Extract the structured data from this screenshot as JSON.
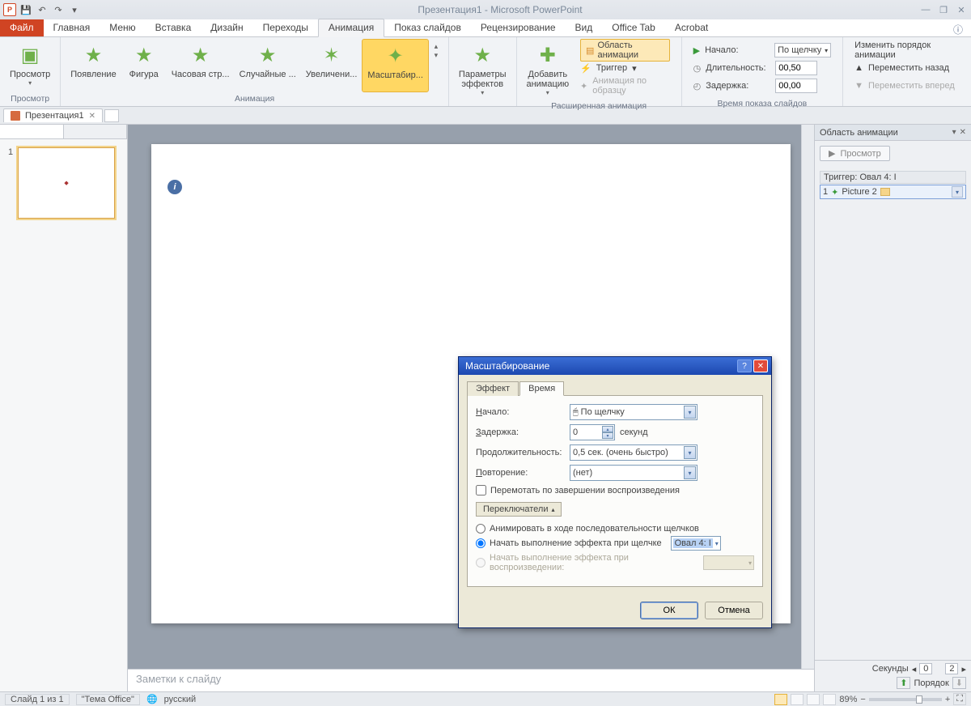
{
  "title": "Презентация1 - Microsoft PowerPoint",
  "menutabs": {
    "file": "Файл",
    "items": [
      "Главная",
      "Меню",
      "Вставка",
      "Дизайн",
      "Переходы",
      "Анимация",
      "Показ слайдов",
      "Рецензирование",
      "Вид",
      "Office Tab",
      "Acrobat"
    ],
    "active_index": 5
  },
  "ribbon": {
    "preview": {
      "label": "Просмотр",
      "group": "Просмотр"
    },
    "anim_gallery": {
      "items": [
        "Появление",
        "Фигура",
        "Часовая стр...",
        "Случайные ...",
        "Увеличени...",
        "Масштабир..."
      ],
      "selected_index": 5,
      "group": "Анимация"
    },
    "effect_options": "Параметры эффектов",
    "add_anim": "Добавить анимацию",
    "ext_anim": {
      "pane": "Область анимации",
      "trigger": "Триггер",
      "painter": "Анимация по образцу",
      "group": "Расширенная анимация"
    },
    "timing": {
      "start_lbl": "Начало:",
      "start_val": "По щелчку",
      "duration_lbl": "Длительность:",
      "duration_val": "00,50",
      "delay_lbl": "Задержка:",
      "delay_val": "00,00",
      "group": "Время показа слайдов"
    },
    "reorder": {
      "title": "Изменить порядок анимации",
      "back": "Переместить назад",
      "fwd": "Переместить вперед"
    }
  },
  "doctab": {
    "name": "Презентация1"
  },
  "thumb": {
    "num": "1"
  },
  "notes_placeholder": "Заметки к слайду",
  "anim_pane": {
    "title": "Область анимации",
    "play": "Просмотр",
    "trigger_hdr": "Триггер: Овал 4: I",
    "item_num": "1",
    "item_name": "Picture 2",
    "seconds": "Секунды",
    "sec_a": "0",
    "sec_b": "2",
    "reorder": "Порядок"
  },
  "dialog": {
    "title": "Масштабирование",
    "tab_effect": "Эффект",
    "tab_time": "Время",
    "start_lbl": "Начало:",
    "start_val": "По щелчку",
    "delay_lbl": "Задержка:",
    "delay_val": "0",
    "delay_unit": "секунд",
    "duration_lbl": "Продолжительность:",
    "duration_val": "0,5 сек. (очень быстро)",
    "repeat_lbl": "Повторение:",
    "repeat_val": "(нет)",
    "rewind": "Перемотать по завершении воспроизведения",
    "triggers_btn": "Переключатели",
    "radio1": "Анимировать в ходе последовательности щелчков",
    "radio2": "Начать выполнение эффекта при щелчке",
    "radio2_val": "Овал 4: I",
    "radio3": "Начать выполнение эффекта при воспроизведении:",
    "ok": "ОК",
    "cancel": "Отмена"
  },
  "status": {
    "slide": "Слайд 1 из 1",
    "theme": "\"Тема Office\"",
    "lang": "русский",
    "zoom": "89%"
  }
}
